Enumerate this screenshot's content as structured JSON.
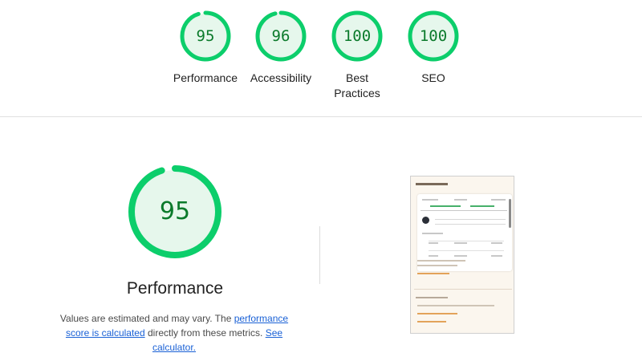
{
  "gauges": [
    {
      "score": "95",
      "label": "Performance",
      "fraction": 0.95
    },
    {
      "score": "96",
      "label": "Accessibility",
      "fraction": 0.96
    },
    {
      "score": "100",
      "label": "Best Practices",
      "fraction": 1.0
    },
    {
      "score": "100",
      "label": "SEO",
      "fraction": 1.0
    }
  ],
  "performance": {
    "score": "95",
    "fraction": 0.95,
    "title": "Performance",
    "desc_part1": "Values are estimated and may vary. The ",
    "link_score": "performance score is calculated",
    "desc_part2": " directly from these metrics. ",
    "link_calc": "See calculator."
  },
  "colors": {
    "pass_ring": "#0cce6b",
    "pass_fill": "#e6f7ec",
    "pass_text": "#0b7a2b",
    "link": "#1a61d6"
  }
}
